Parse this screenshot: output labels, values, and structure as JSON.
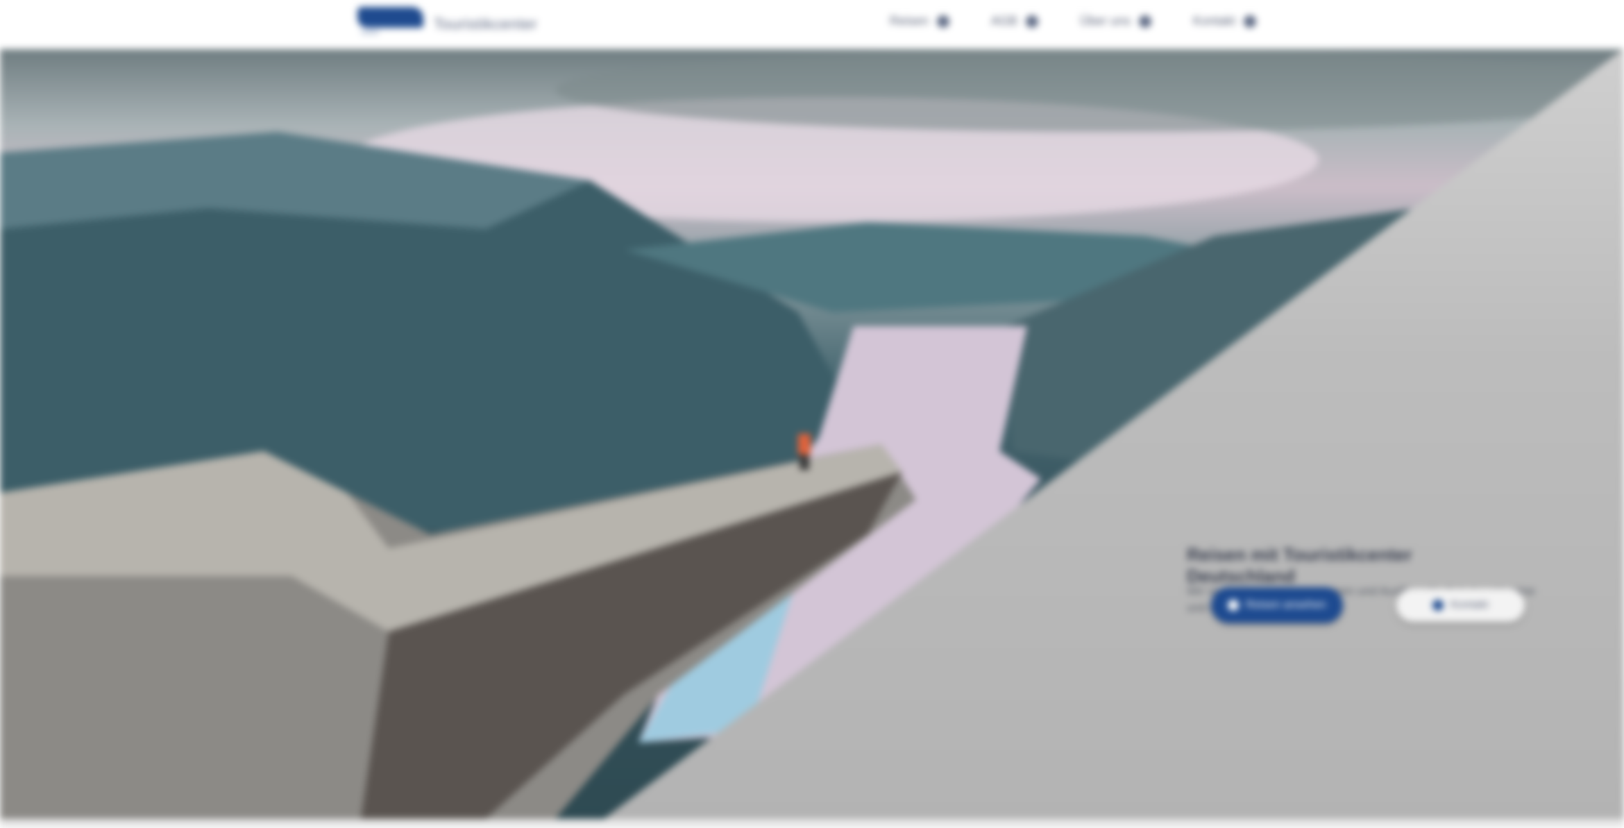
{
  "header": {
    "brand_name": "Touristikcenter",
    "nav": [
      {
        "label": "Reisen",
        "icon": "airplane-icon"
      },
      {
        "label": "AGB",
        "icon": "document-icon"
      },
      {
        "label": "Über uns",
        "icon": "info-icon"
      },
      {
        "label": "Kontakt",
        "icon": "phone-icon"
      }
    ]
  },
  "hero": {
    "title": "Reisen mit Touristikcenter Deutschland",
    "text": "Wir organisieren Gruppenreisen und Ausflüge für Schulen, Vereine und Firmen.",
    "primary_button": "Reisen ansehen",
    "secondary_button": "Kontakt",
    "colors": {
      "accent": "#1d4a90",
      "panel": "#bdbdbd"
    }
  }
}
